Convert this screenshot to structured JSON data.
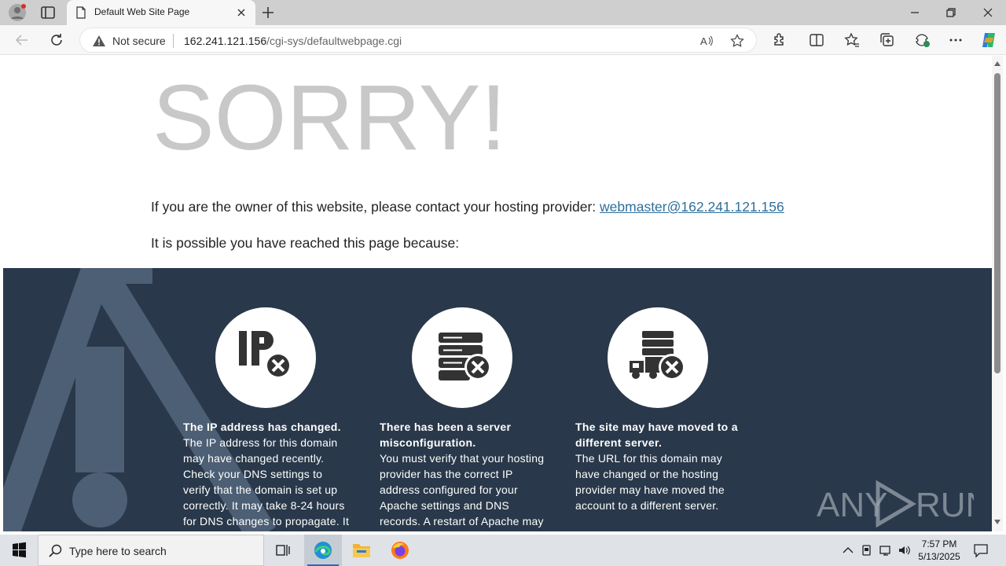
{
  "browser": {
    "tab_title": "Default Web Site Page",
    "security_label": "Not secure",
    "url_host": "162.241.121.156",
    "url_path": "/cgi-sys/defaultwebpage.cgi"
  },
  "page": {
    "heading": "SORRY!",
    "owner_text": "If you are the owner of this website, please contact your hosting provider:",
    "owner_email": "webmaster@162.241.121.156",
    "possible_text": "It is possible you have reached this page because:",
    "reasons": [
      {
        "title": "The IP address has changed.",
        "body": "The IP address for this domain may have changed recently. Check your DNS settings to verify that the domain is set up correctly. It may take 8-24 hours for DNS changes to propagate. It"
      },
      {
        "title": "There has been a server misconfiguration.",
        "body": "You must verify that your hosting provider has the correct IP address configured for your Apache settings and DNS records. A restart of Apache may"
      },
      {
        "title": "The site may have moved to a different server.",
        "body": "The URL for this domain may have changed or the hosting provider may have moved the account to a different server."
      }
    ],
    "watermark": "ANY RUN"
  },
  "taskbar": {
    "search_placeholder": "Type here to search",
    "time": "7:57 PM",
    "date": "5/13/2025"
  },
  "colors": {
    "dark_panel": "#29384a",
    "link": "#2e6f9c",
    "sorry": "#c8c8c8"
  }
}
